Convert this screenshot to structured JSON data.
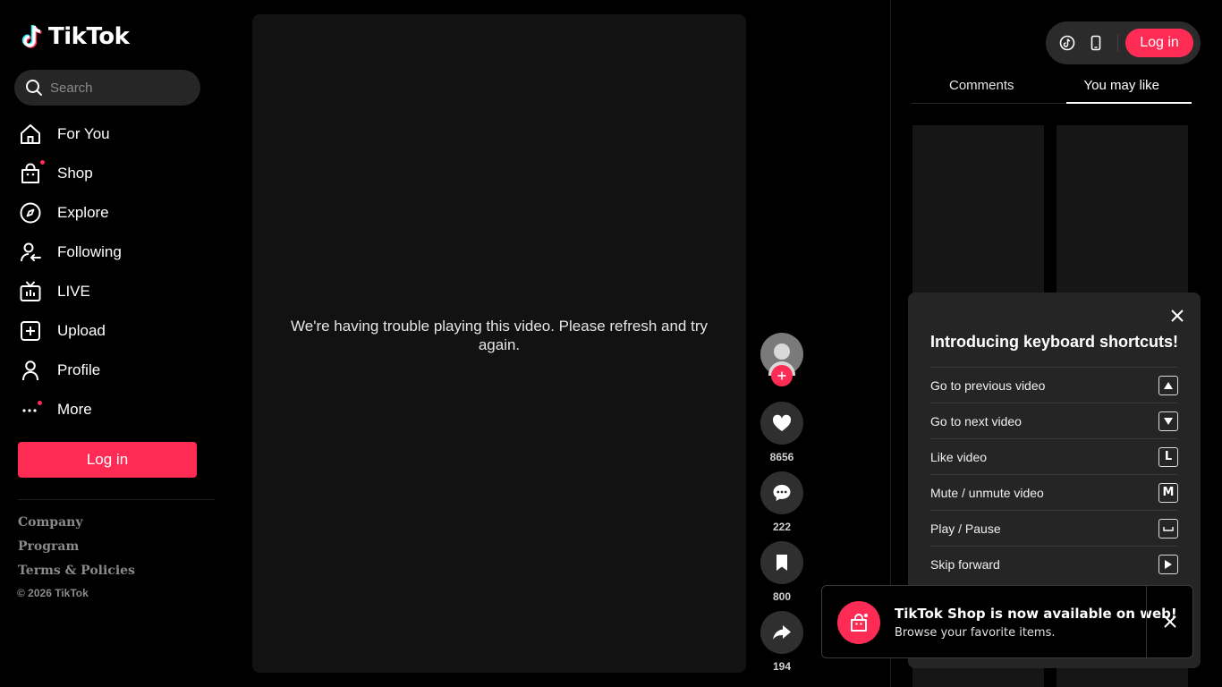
{
  "brand": {
    "name": "TikTok",
    "accent": "#fe2c55"
  },
  "search": {
    "placeholder": "Search"
  },
  "nav": [
    {
      "label": "For You",
      "icon": "home-icon"
    },
    {
      "label": "Shop",
      "icon": "shop-bag-icon"
    },
    {
      "label": "Explore",
      "icon": "compass-icon"
    },
    {
      "label": "Following",
      "icon": "following-user-icon"
    },
    {
      "label": "LIVE",
      "icon": "live-tv-icon"
    },
    {
      "label": "Upload",
      "icon": "upload-plus-icon"
    },
    {
      "label": "Profile",
      "icon": "profile-icon"
    },
    {
      "label": "More",
      "icon": "more-dots-icon"
    }
  ],
  "sidebar": {
    "login_label": "Log in",
    "footer_links": [
      "Company",
      "Program",
      "Terms & Policies"
    ],
    "copyright": "© 2026 TikTok"
  },
  "video": {
    "error_message": "We're having trouble playing this video. Please refresh and try again."
  },
  "actions": {
    "likes": "8656",
    "comments": "222",
    "saves": "800",
    "shares": "194"
  },
  "topbar": {
    "login_label": "Log in"
  },
  "tabs": [
    {
      "label": "Comments",
      "active": false
    },
    {
      "label": "You may like",
      "active": true
    }
  ],
  "shortcuts": {
    "title": "Introducing keyboard shortcuts!",
    "items": [
      {
        "label": "Go to previous video",
        "key": "up-arrow-key-icon"
      },
      {
        "label": "Go to next video",
        "key": "down-arrow-key-icon"
      },
      {
        "label": "Like video",
        "key": "L"
      },
      {
        "label": "Mute / unmute video",
        "key": "M"
      },
      {
        "label": "Play / Pause",
        "key": "space-key-icon"
      },
      {
        "label": "Skip forward",
        "key": "right-arrow-key-icon"
      }
    ]
  },
  "toast": {
    "title": "TikTok Shop is now available on web!",
    "subtitle": "Browse your favorite items."
  }
}
